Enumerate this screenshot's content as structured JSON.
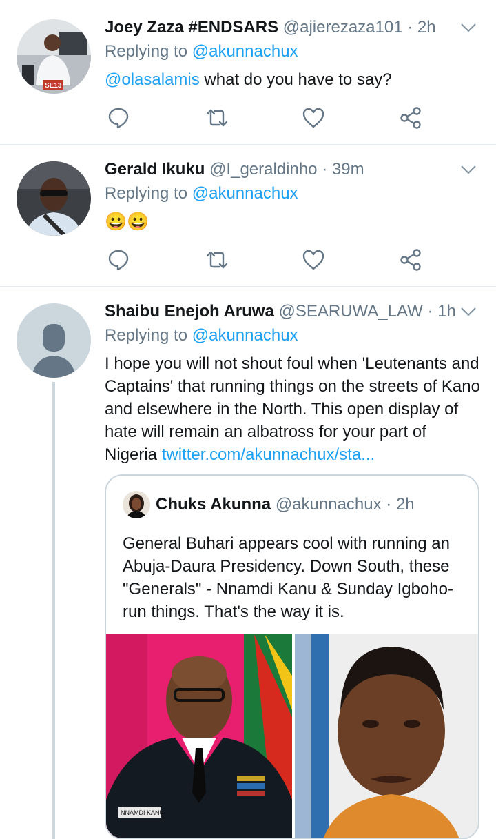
{
  "tweets": [
    {
      "name": "Joey Zaza #ENDSARS",
      "handle": "@ajierezaza101",
      "time": "2h",
      "reply_prefix": "Replying to ",
      "reply_to": "@akunnachux",
      "mention": "@olasalamis",
      "text": " what do you have to say?",
      "avatar_badge": "SE13"
    },
    {
      "name": "Gerald Ikuku",
      "handle": "@I_geraldinho",
      "time": "39m",
      "reply_prefix": "Replying to ",
      "reply_to": "@akunnachux",
      "text": "😀😀"
    },
    {
      "name": "Shaibu Enejoh Aruwa",
      "handle": "@SEARUWA_LAW",
      "time": "1h",
      "reply_prefix": "Replying to ",
      "reply_to": "@akunnachux",
      "text": "I hope you will not shout foul when 'Leutenants and Captains' that running things on the streets of Kano and elsewhere in the North. This open display of hate will remain an albatross for your part of Nigeria ",
      "link": "twitter.com/akunnachux/sta..."
    }
  ],
  "quote": {
    "name": "Chuks Akunna",
    "handle": "@akunnachux",
    "time": "2h",
    "text": "General Buhari appears cool with running an Abuja-Daura Presidency. Down South, these \"Generals\" - Nnamdi Kanu & Sunday Igboho- run things. That's the way it is.",
    "image_left_name_tag": "NNAMDI KANU"
  },
  "separator": "·",
  "icons": [
    "reply-icon",
    "retweet-icon",
    "like-icon",
    "share-icon",
    "chevron-down-icon"
  ],
  "colors": {
    "accent": "#1da1f2",
    "muted": "#657786",
    "text": "#14171a",
    "border": "#e6ecf0"
  }
}
